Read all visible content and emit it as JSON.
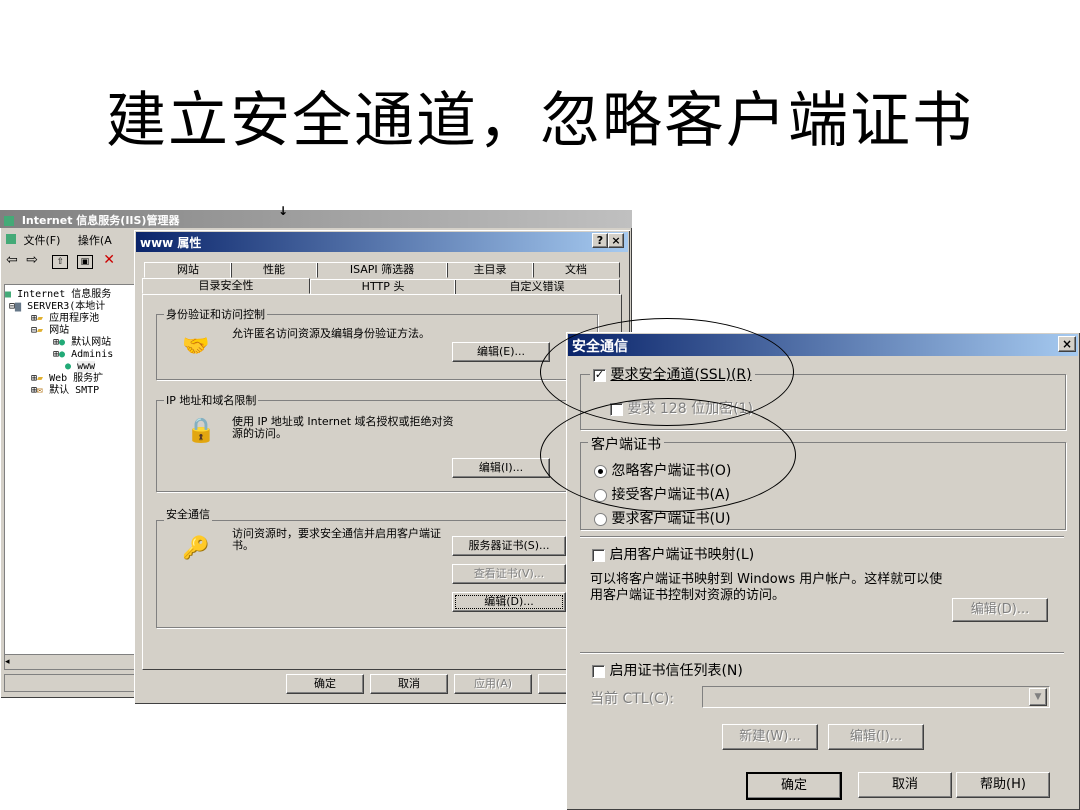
{
  "slide": {
    "title": "建立安全通道，忽略客户端证书"
  },
  "iis": {
    "title": "Internet 信息服务(IIS)管理器",
    "menu": [
      "文件(F)",
      "操作(A"
    ],
    "tree": [
      "Internet 信息服务",
      "SERVER3(本地计",
      "应用程序池",
      "网站",
      "默认网站",
      "Adminis",
      "www",
      "Web 服务扩",
      "默认 SMTP"
    ]
  },
  "props": {
    "title": "www 属性",
    "help_btn": "?",
    "close_btn": "×",
    "tabs_back": [
      "网站",
      "性能",
      "ISAPI 筛选器",
      "主目录",
      "文档"
    ],
    "tabs_front": [
      "目录安全性",
      "HTTP 头",
      "自定义错误"
    ],
    "auth": {
      "label": "身份验证和访问控制",
      "text": "允许匿名访问资源及编辑身份验证方法。",
      "edit": "编辑(E)..."
    },
    "ip": {
      "label": "IP 地址和域名限制",
      "text": "使用 IP 地址或 Internet 域名授权或拒绝对资源的访问。",
      "edit": "编辑(I)..."
    },
    "secure": {
      "label": "安全通信",
      "text": "访问资源时，要求安全通信并启用客户端证书。",
      "server_cert": "服务器证书(S)...",
      "view_cert": "查看证书(V)...",
      "edit": "编辑(D)..."
    },
    "footer": {
      "ok": "确定",
      "cancel": "取消",
      "apply": "应用(A)"
    }
  },
  "ssl": {
    "title": "安全通信",
    "close_btn": "×",
    "require_ssl": "要求安全通道(SSL)(R)",
    "require_128": "要求 128 位加密(1)",
    "client_cert_label": "客户端证书",
    "ignore": "忽略客户端证书(O)",
    "accept": "接受客户端证书(A)",
    "require": "要求客户端证书(U)",
    "mapping": "启用客户端证书映射(L)",
    "mapping_text": "可以将客户端证书映射到 Windows 用户帐户。这样就可以使用客户端证书控制对资源的访问。",
    "mapping_edit": "编辑(D)...",
    "ctl": "启用证书信任列表(N)",
    "current_ctl": "当前 CTL(C):",
    "new_btn": "新建(W)...",
    "edit_btn": "编辑(I)...",
    "ok": "确定",
    "cancel": "取消",
    "help": "帮助(H)"
  }
}
